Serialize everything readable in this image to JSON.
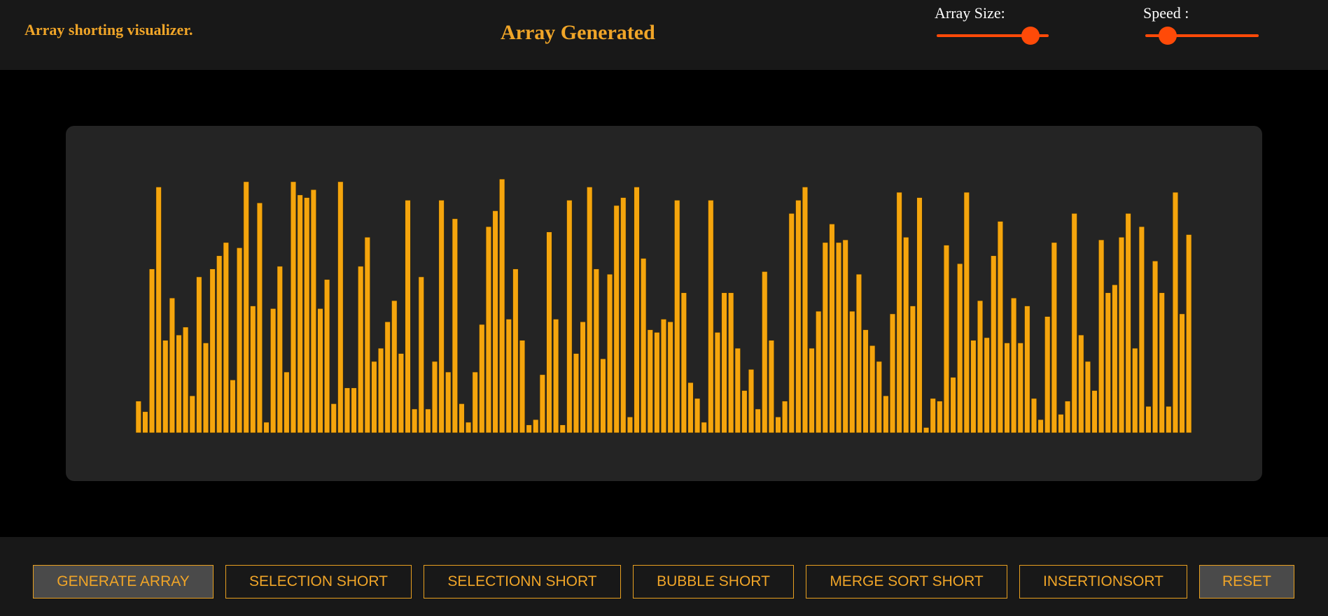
{
  "header": {
    "app_title": "Array shorting visualizer.",
    "status": "Array Generated",
    "array_size_label": "Array Size:",
    "speed_label": "Speed :",
    "array_size_value": 0.9,
    "speed_value": 0.14
  },
  "colors": {
    "accent": "#f0a528",
    "bar": "#f5a50d",
    "slider": "#ff4a08",
    "header_bg": "#181818",
    "stage_bg": "#242424"
  },
  "bars": [
    12,
    8,
    62,
    93,
    35,
    51,
    37,
    40,
    14,
    59,
    34,
    62,
    67,
    72,
    20,
    70,
    95,
    48,
    87,
    4,
    47,
    63,
    23,
    95,
    90,
    89,
    92,
    47,
    58,
    11,
    95,
    17,
    17,
    63,
    74,
    27,
    32,
    42,
    50,
    30,
    88,
    9,
    59,
    9,
    27,
    88,
    23,
    81,
    11,
    4,
    23,
    41,
    78,
    84,
    96,
    43,
    62,
    35,
    3,
    5,
    22,
    76,
    43,
    3,
    88,
    30,
    42,
    93,
    62,
    28,
    60,
    86,
    89,
    6,
    93,
    66,
    39,
    38,
    43,
    42,
    88,
    53,
    19,
    13,
    4,
    88,
    38,
    53,
    53,
    32,
    16,
    24,
    9,
    61,
    35,
    6,
    12,
    83,
    88,
    93,
    32,
    46,
    72,
    79,
    72,
    73,
    46,
    60,
    39,
    33,
    27,
    14,
    45,
    91,
    74,
    48,
    89,
    2,
    13,
    12,
    71,
    21,
    64,
    91,
    35,
    50,
    36,
    67,
    80,
    34,
    51,
    34,
    48,
    13,
    5,
    44,
    72,
    7,
    12,
    83,
    37,
    27,
    16,
    73,
    53,
    56,
    74,
    83,
    32,
    78,
    10,
    65,
    53,
    10,
    91,
    45,
    75
  ],
  "footer": {
    "buttons": [
      {
        "label": "GENERATE ARRAY"
      },
      {
        "label": "SELECTION SHORT"
      },
      {
        "label": "SELECTIONN SHORT"
      },
      {
        "label": "BUBBLE SHORT"
      },
      {
        "label": "MERGE SORT SHORT"
      },
      {
        "label": "INSERTIONSORT"
      },
      {
        "label": "RESET"
      }
    ]
  }
}
